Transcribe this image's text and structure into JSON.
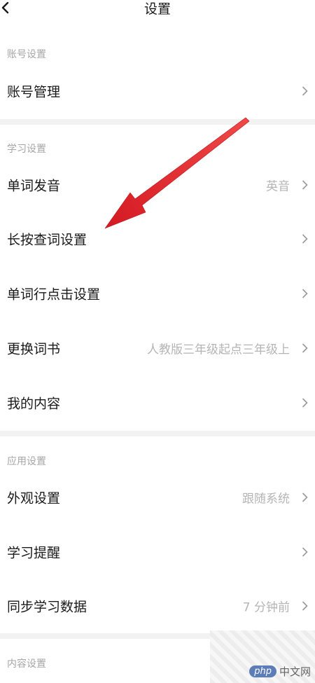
{
  "header": {
    "title": "设置",
    "back_icon": "chevron-left-icon"
  },
  "sections": {
    "account": {
      "header": "账号设置",
      "rows": [
        {
          "label": "账号管理",
          "value": ""
        }
      ]
    },
    "study": {
      "header": "学习设置",
      "rows": [
        {
          "label": "单词发音",
          "value": "英音"
        },
        {
          "label": "长按查词设置",
          "value": ""
        },
        {
          "label": "单词行点击设置",
          "value": ""
        },
        {
          "label": "更换词书",
          "value": "人教版三年级起点三年级上"
        },
        {
          "label": "我的内容",
          "value": ""
        }
      ]
    },
    "app": {
      "header": "应用设置",
      "rows": [
        {
          "label": "外观设置",
          "value": "跟随系统"
        },
        {
          "label": "学习提醒",
          "value": ""
        },
        {
          "label": "同步学习数据",
          "value": "7 分钟前"
        }
      ]
    },
    "content": {
      "header": "内容设置"
    }
  },
  "annotation": {
    "arrow_color": "#e0202a"
  },
  "watermark": {
    "badge": "php",
    "text": "中文网"
  },
  "colors": {
    "background": "#ffffff",
    "divider": "#f2f2f2",
    "label": "#1a1a1a",
    "secondary": "#b5b5b5",
    "section_header": "#a6a6a6"
  }
}
